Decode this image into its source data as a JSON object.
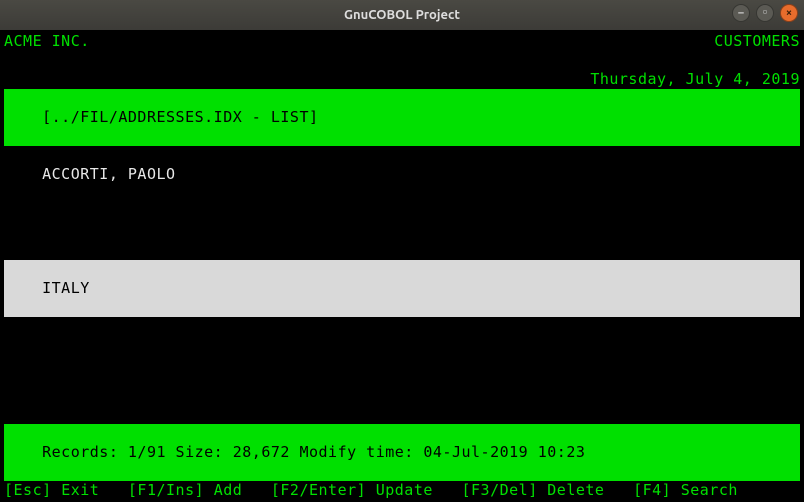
{
  "window": {
    "title": "GnuCOBOL Project"
  },
  "header": {
    "company": "ACME INC.",
    "module": "CUSTOMERS",
    "date": "Thursday, July 4, 2019"
  },
  "listbar": {
    "text": "[../FIL/ADDRESSES.IDX - LIST]"
  },
  "record": {
    "line1": "ACCORTI, PAOLO",
    "line2": "",
    "line3": "ITALY"
  },
  "status": {
    "text": "Records: 1/91 Size: 28,672 Modify time: 04-Jul-2019 10:23",
    "records_current": 1,
    "records_total": 91,
    "size": "28,672",
    "modify_time": "04-Jul-2019 10:23"
  },
  "footer": {
    "keys": [
      {
        "key": "[Esc]",
        "label": "Exit"
      },
      {
        "key": "[F1/Ins]",
        "label": "Add"
      },
      {
        "key": "[F2/Enter]",
        "label": "Update"
      },
      {
        "key": "[F3/Del]",
        "label": "Delete"
      },
      {
        "key": "[F4]",
        "label": "Search"
      }
    ]
  },
  "colors": {
    "term_green": "#00e000",
    "highlight_bg": "#00e000",
    "select_bg": "#d9d9d9"
  }
}
